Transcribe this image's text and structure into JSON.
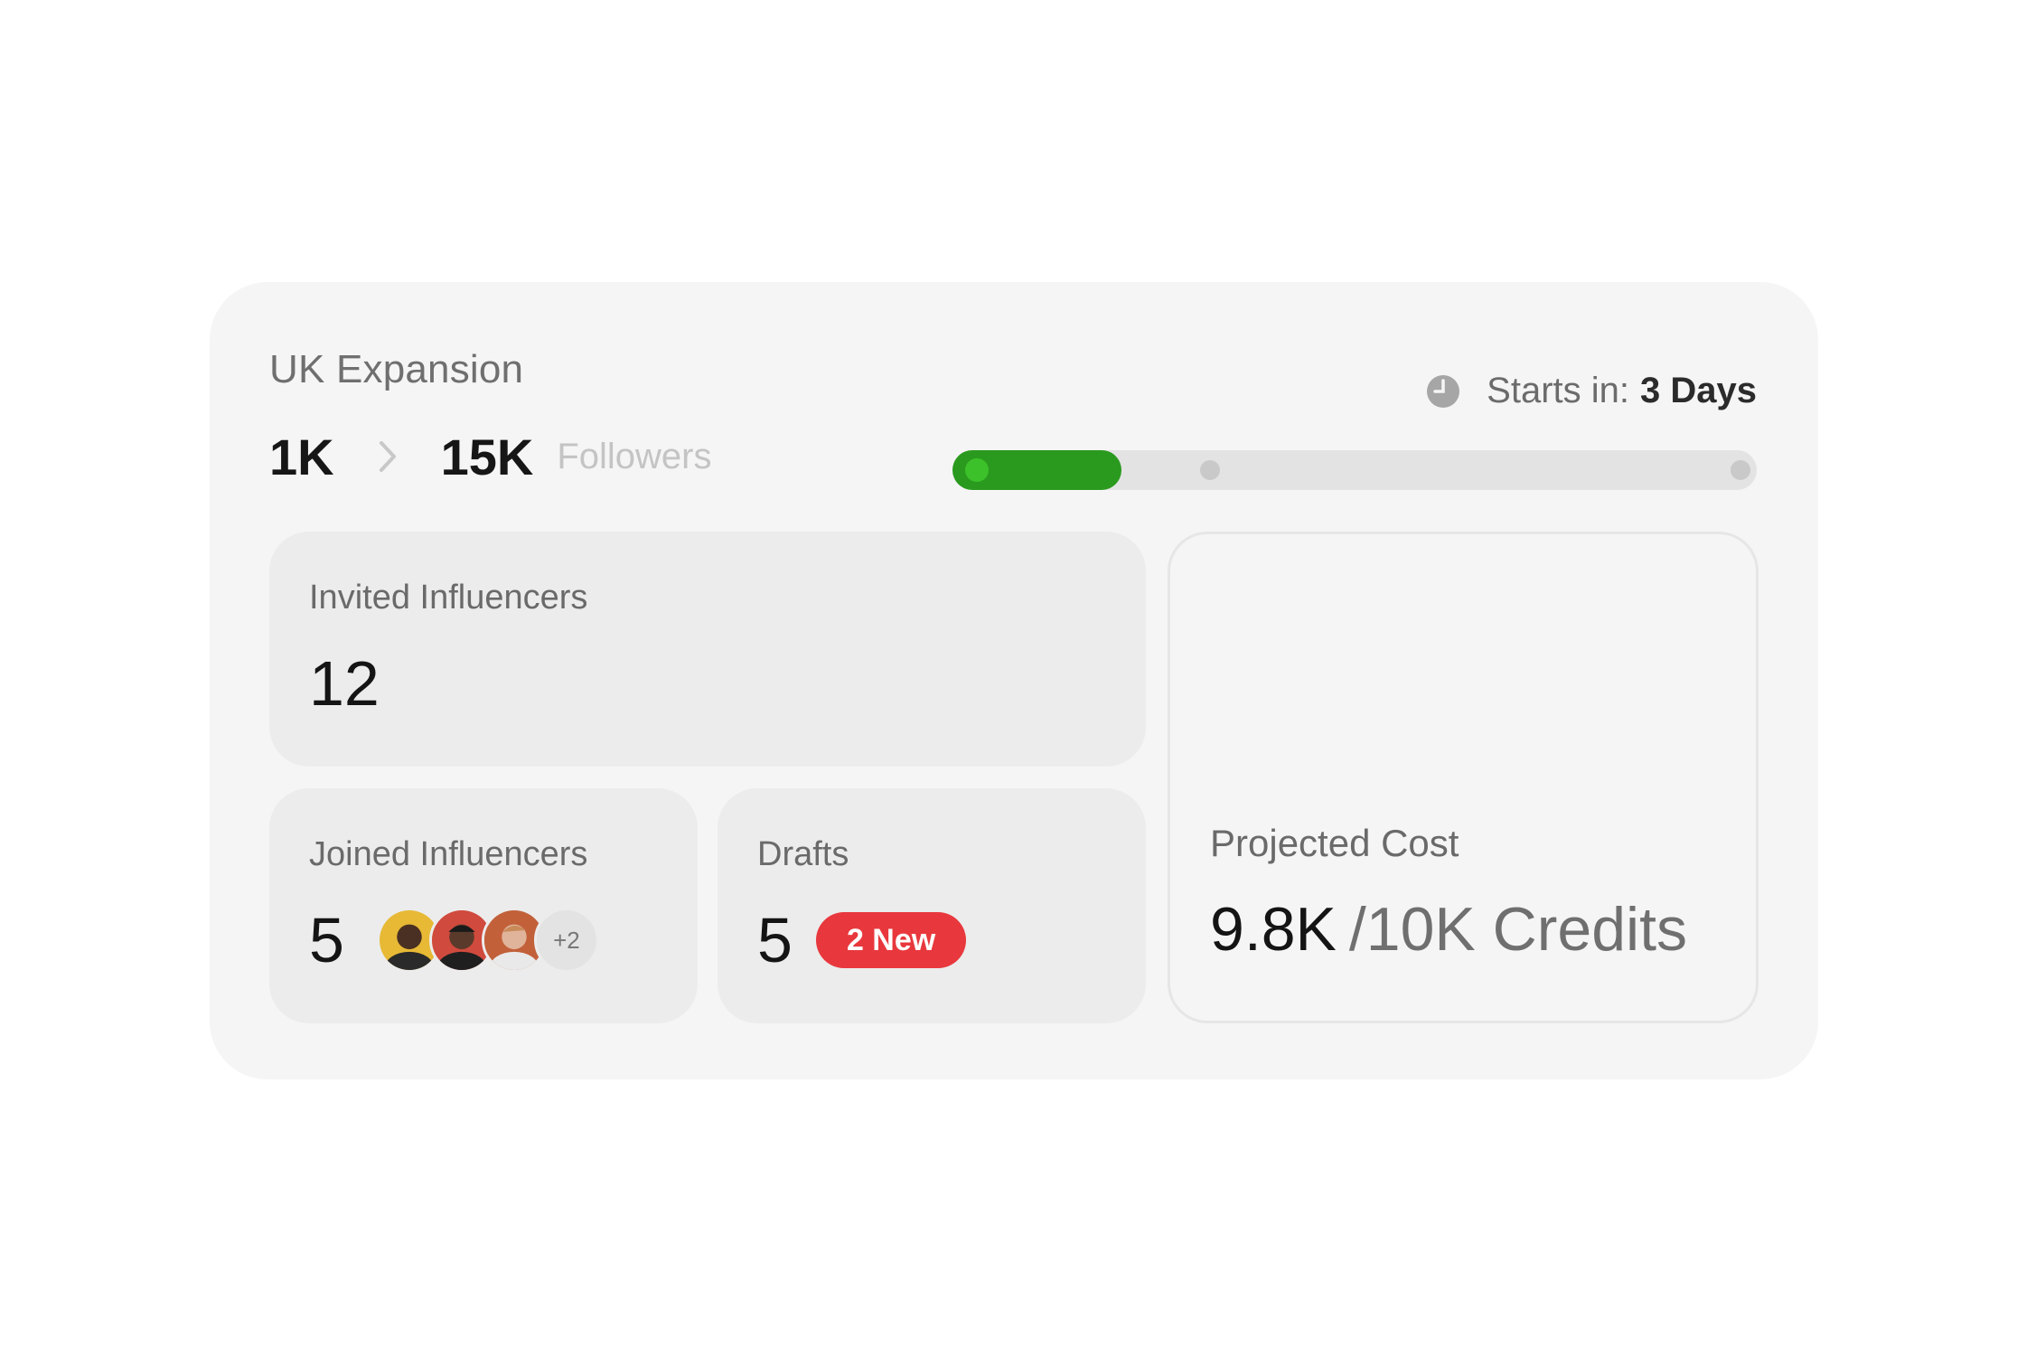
{
  "campaign": {
    "title": "UK Expansion",
    "followers_from": "1K",
    "followers_to": "15K",
    "followers_label": "Followers",
    "starts_label": "Starts in:",
    "starts_value": "3 Days",
    "progress_fraction": 0.21,
    "milestones": [
      0.0,
      0.32,
      0.98
    ],
    "accent_color": "#2a9a1e"
  },
  "invited": {
    "label": "Invited Influencers",
    "value": "12"
  },
  "joined": {
    "label": "Joined Influencers",
    "value": "5",
    "avatars": [
      "avatar-1",
      "avatar-2",
      "avatar-3"
    ],
    "more_label": "+2"
  },
  "drafts": {
    "label": "Drafts",
    "value": "5",
    "badge": "2 New",
    "badge_color": "#e8383d"
  },
  "cost": {
    "label": "Projected Cost",
    "value": "9.8K",
    "total": "/10K Credits"
  }
}
